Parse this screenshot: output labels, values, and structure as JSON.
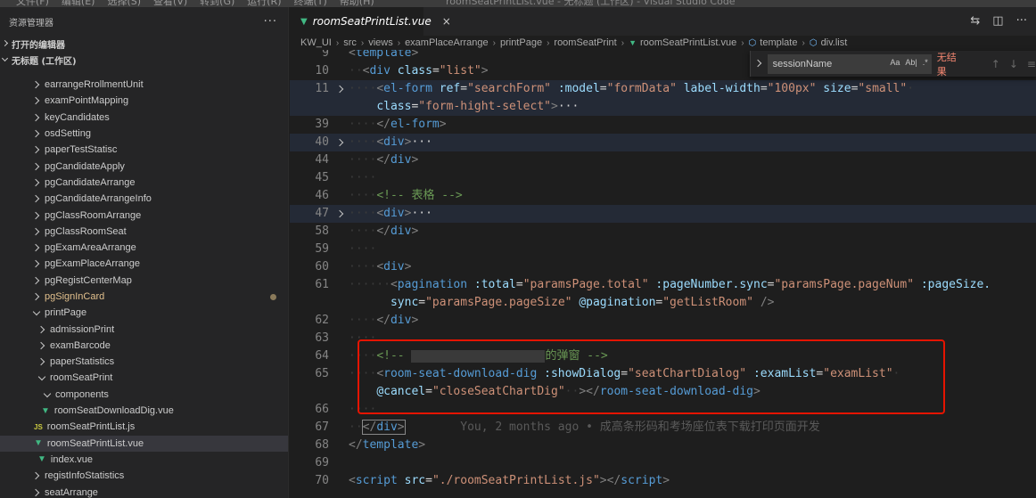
{
  "titlebar": {
    "menu": [
      "文件(F)",
      "编辑(E)",
      "选择(S)",
      "查看(V)",
      "转到(G)",
      "运行(R)",
      "终端(T)",
      "帮助(H)"
    ],
    "title": "roomSeatPrintList.vue - 无标题 (工作区) - Visual Studio Code"
  },
  "sidebar": {
    "title": "资源管理器",
    "more_icon": "ellipsis-icon",
    "open_editors": "打开的编辑器",
    "workspace": "无标题 (工作区)",
    "items": [
      {
        "label": "earrangeRrollmentUnit",
        "type": "folder",
        "depth": 0
      },
      {
        "label": "examPointMapping",
        "type": "folder",
        "depth": 0
      },
      {
        "label": "keyCandidates",
        "type": "folder",
        "depth": 0
      },
      {
        "label": "osdSetting",
        "type": "folder",
        "depth": 0
      },
      {
        "label": "paperTestStatisc",
        "type": "folder",
        "depth": 0
      },
      {
        "label": "pgCandidateApply",
        "type": "folder",
        "depth": 0
      },
      {
        "label": "pgCandidateArrange",
        "type": "folder",
        "depth": 0
      },
      {
        "label": "pgCandidateArrangeInfo",
        "type": "folder",
        "depth": 0
      },
      {
        "label": "pgClassRoomArrange",
        "type": "folder",
        "depth": 0
      },
      {
        "label": "pgClassRoomSeat",
        "type": "folder",
        "depth": 0
      },
      {
        "label": "pgExamAreaArrange",
        "type": "folder",
        "depth": 0
      },
      {
        "label": "pgExamPlaceArrange",
        "type": "folder",
        "depth": 0
      },
      {
        "label": "pgRegistCenterMap",
        "type": "folder",
        "depth": 0
      },
      {
        "label": "pgSignInCard",
        "type": "folder",
        "depth": 0,
        "modified": true
      },
      {
        "label": "printPage",
        "type": "folder-open",
        "depth": 0
      },
      {
        "label": "admissionPrint",
        "type": "folder",
        "depth": 1
      },
      {
        "label": "examBarcode",
        "type": "folder",
        "depth": 1
      },
      {
        "label": "paperStatistics",
        "type": "folder",
        "depth": 1
      },
      {
        "label": "roomSeatPrint",
        "type": "folder-open",
        "depth": 1
      },
      {
        "label": "components",
        "type": "folder-open",
        "depth": 2
      },
      {
        "label": "roomSeatDownloadDig.vue",
        "type": "vue",
        "depth": 3
      },
      {
        "label": "roomSeatPrintList.js",
        "type": "js",
        "depth": 2
      },
      {
        "label": "roomSeatPrintList.vue",
        "type": "vue",
        "depth": 2,
        "selected": true
      },
      {
        "label": "index.vue",
        "type": "vue",
        "depth": 1
      },
      {
        "label": "registInfoStatistics",
        "type": "folder",
        "depth": 0
      },
      {
        "label": "seatArrange",
        "type": "folder",
        "depth": 0
      }
    ]
  },
  "tab": {
    "label": "roomSeatPrintList.vue",
    "close": "×",
    "actions": [
      "split-compare-icon",
      "split-editor-icon",
      "more-icon"
    ]
  },
  "breadcrumb": [
    "KW_UI",
    "src",
    "views",
    "examPlaceArrange",
    "printPage",
    "roomSeatPrint",
    "roomSeatPrintList.vue",
    "template",
    "div.list"
  ],
  "find": {
    "query": "sessionName",
    "options": [
      "Aa",
      "Ab|",
      ".*"
    ],
    "result": "无结果",
    "accent_no_result": "#f48771"
  },
  "editor": {
    "lines": [
      {
        "n": "9",
        "segs": [
          [
            "p",
            "<"
          ],
          [
            "t",
            "template"
          ],
          [
            "p",
            ">"
          ]
        ]
      },
      {
        "n": "10",
        "segs": [
          [
            "ws",
            "··"
          ],
          [
            "p",
            "<"
          ],
          [
            "t",
            "div"
          ],
          [
            "d",
            " "
          ],
          [
            "a",
            "class"
          ],
          [
            "d",
            "="
          ],
          [
            "s",
            "\"list\""
          ],
          [
            "p",
            ">"
          ]
        ]
      },
      {
        "n": "11",
        "fold": true,
        "hl": true,
        "segs": [
          [
            "ws",
            "····"
          ],
          [
            "p",
            "<"
          ],
          [
            "t",
            "el-form"
          ],
          [
            "d",
            " "
          ],
          [
            "a",
            "ref"
          ],
          [
            "d",
            "="
          ],
          [
            "s",
            "\"searchForm\""
          ],
          [
            "d",
            " "
          ],
          [
            "a",
            ":model"
          ],
          [
            "d",
            "="
          ],
          [
            "s",
            "\"formData\""
          ],
          [
            "d",
            " "
          ],
          [
            "a",
            "label-width"
          ],
          [
            "d",
            "="
          ],
          [
            "s",
            "\"100px\""
          ],
          [
            "d",
            " "
          ],
          [
            "a",
            "size"
          ],
          [
            "d",
            "="
          ],
          [
            "s",
            "\"small\""
          ],
          [
            "ws",
            "·"
          ]
        ]
      },
      {
        "n": "",
        "hl": true,
        "segs": [
          [
            "ws",
            "    "
          ],
          [
            "a",
            "class"
          ],
          [
            "d",
            "="
          ],
          [
            "s",
            "\"form-hight-select\""
          ],
          [
            "p",
            ">"
          ],
          [
            "ell",
            "···"
          ]
        ]
      },
      {
        "n": "39",
        "segs": [
          [
            "ws",
            "····"
          ],
          [
            "p",
            "</"
          ],
          [
            "t",
            "el-form"
          ],
          [
            "p",
            ">"
          ]
        ]
      },
      {
        "n": "40",
        "fold": true,
        "hl": true,
        "segs": [
          [
            "ws",
            "····"
          ],
          [
            "p",
            "<"
          ],
          [
            "t",
            "div"
          ],
          [
            "p",
            ">"
          ],
          [
            "ell",
            "···"
          ]
        ]
      },
      {
        "n": "44",
        "segs": [
          [
            "ws",
            "····"
          ],
          [
            "p",
            "</"
          ],
          [
            "t",
            "div"
          ],
          [
            "p",
            ">"
          ]
        ]
      },
      {
        "n": "45",
        "segs": [
          [
            "ws",
            "····"
          ]
        ]
      },
      {
        "n": "46",
        "segs": [
          [
            "ws",
            "····"
          ],
          [
            "c",
            "<!-- 表格 -->"
          ]
        ]
      },
      {
        "n": "47",
        "fold": true,
        "hl": true,
        "segs": [
          [
            "ws",
            "····"
          ],
          [
            "p",
            "<"
          ],
          [
            "t",
            "div"
          ],
          [
            "p",
            ">"
          ],
          [
            "ell",
            "···"
          ]
        ]
      },
      {
        "n": "58",
        "segs": [
          [
            "ws",
            "····"
          ],
          [
            "p",
            "</"
          ],
          [
            "t",
            "div"
          ],
          [
            "p",
            ">"
          ]
        ]
      },
      {
        "n": "59",
        "segs": [
          [
            "ws",
            "····"
          ]
        ]
      },
      {
        "n": "60",
        "segs": [
          [
            "ws",
            "····"
          ],
          [
            "p",
            "<"
          ],
          [
            "t",
            "div"
          ],
          [
            "p",
            ">"
          ]
        ]
      },
      {
        "n": "61",
        "segs": [
          [
            "ws",
            "······"
          ],
          [
            "p",
            "<"
          ],
          [
            "t",
            "pagination"
          ],
          [
            "d",
            " "
          ],
          [
            "a",
            ":total"
          ],
          [
            "d",
            "="
          ],
          [
            "s",
            "\"paramsPage.total\""
          ],
          [
            "d",
            " "
          ],
          [
            "a",
            ":pageNumber.sync"
          ],
          [
            "d",
            "="
          ],
          [
            "s",
            "\"paramsPage.pageNum\""
          ],
          [
            "d",
            " "
          ],
          [
            "a",
            ":pageSize."
          ]
        ]
      },
      {
        "n": "",
        "segs": [
          [
            "ws",
            "      "
          ],
          [
            "a",
            "sync"
          ],
          [
            "d",
            "="
          ],
          [
            "s",
            "\"paramsPage.pageSize\""
          ],
          [
            "d",
            " "
          ],
          [
            "a",
            "@pagination"
          ],
          [
            "d",
            "="
          ],
          [
            "s",
            "\"getListRoom\""
          ],
          [
            "d",
            " "
          ],
          [
            "p",
            "/>"
          ]
        ]
      },
      {
        "n": "62",
        "segs": [
          [
            "ws",
            "····"
          ],
          [
            "p",
            "</"
          ],
          [
            "t",
            "div"
          ],
          [
            "p",
            ">"
          ]
        ]
      },
      {
        "n": "63",
        "segs": [
          [
            "ws",
            "····"
          ]
        ]
      },
      {
        "n": "64",
        "segs": [
          [
            "ws",
            "····"
          ],
          [
            "c",
            "<!-- "
          ],
          [
            "redact",
            ""
          ],
          [
            "c",
            "的弹窗 -->"
          ]
        ]
      },
      {
        "n": "65",
        "segs": [
          [
            "ws",
            "····"
          ],
          [
            "p",
            "<"
          ],
          [
            "t",
            "room-seat-download-dig"
          ],
          [
            "d",
            " "
          ],
          [
            "a",
            ":showDialog"
          ],
          [
            "d",
            "="
          ],
          [
            "s",
            "\"seatChartDialog\""
          ],
          [
            "d",
            " "
          ],
          [
            "a",
            ":examList"
          ],
          [
            "d",
            "="
          ],
          [
            "s",
            "\"examList\""
          ],
          [
            "ws",
            "·"
          ]
        ]
      },
      {
        "n": "",
        "segs": [
          [
            "ws",
            "    "
          ],
          [
            "a",
            "@cancel"
          ],
          [
            "d",
            "="
          ],
          [
            "s",
            "\"closeSeatChartDig\""
          ],
          [
            "ws",
            "··"
          ],
          [
            "p",
            "></"
          ],
          [
            "t",
            "room-seat-download-dig"
          ],
          [
            "p",
            ">"
          ]
        ]
      },
      {
        "n": "66",
        "segs": [
          [
            "ws",
            "····"
          ]
        ]
      },
      {
        "n": "67",
        "segs": [
          [
            "ws",
            "··"
          ],
          [
            "box",
            "</div>"
          ],
          [
            "blame",
            "        You, 2 months ago • 成高条形码和考场座位表下载打印页面开发"
          ]
        ]
      },
      {
        "n": "68",
        "segs": [
          [
            "p",
            "</"
          ],
          [
            "t",
            "template"
          ],
          [
            "p",
            ">"
          ]
        ]
      },
      {
        "n": "69",
        "segs": []
      },
      {
        "n": "70",
        "segs": [
          [
            "p",
            "<"
          ],
          [
            "t",
            "script"
          ],
          [
            "d",
            " "
          ],
          [
            "a",
            "src"
          ],
          [
            "d",
            "="
          ],
          [
            "s",
            "\"./roomSeatPrintList.js\""
          ],
          [
            "p",
            "></"
          ],
          [
            "t",
            "script"
          ],
          [
            "p",
            ">"
          ]
        ]
      }
    ]
  }
}
